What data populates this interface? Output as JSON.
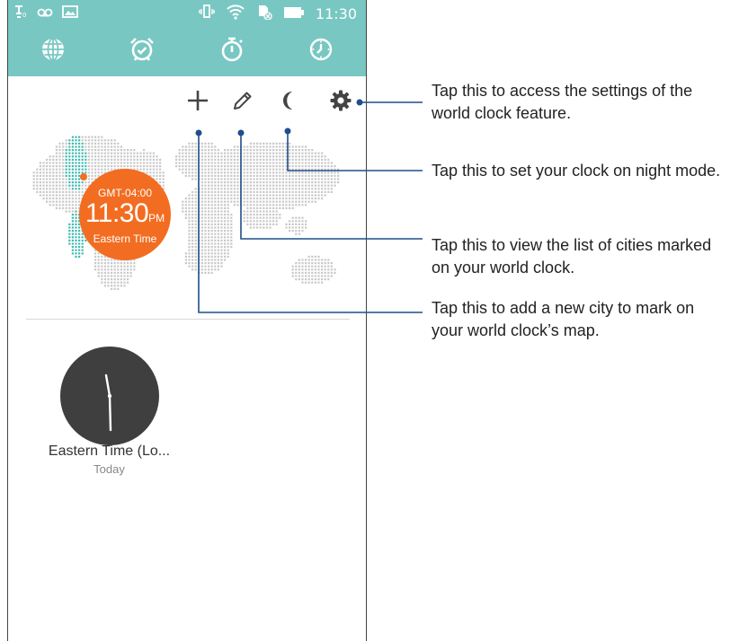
{
  "status_bar": {
    "time": "11:30",
    "icons": [
      "notification-icon",
      "voicemail-icon",
      "image-icon",
      "vibrate-icon",
      "wifi-icon",
      "no-sim-icon",
      "battery-icon"
    ]
  },
  "tabs": [
    {
      "id": "world-clock",
      "icon": "globe-icon",
      "active": true
    },
    {
      "id": "alarm",
      "icon": "alarm-clock-icon",
      "active": false
    },
    {
      "id": "stopwatch",
      "icon": "stopwatch-icon",
      "active": false
    },
    {
      "id": "timer",
      "icon": "timer-icon",
      "active": false
    }
  ],
  "toolbar": {
    "add_icon": "plus-icon",
    "edit_icon": "pencil-icon",
    "night_icon": "moon-icon",
    "settings_icon": "gear-icon"
  },
  "map_badge": {
    "gmt": "GMT-04:00",
    "time": "11:30",
    "ampm": "PM",
    "zone": "Eastern Time"
  },
  "city_card": {
    "name": "Eastern Time (Lo...",
    "day": "Today"
  },
  "callouts": [
    {
      "target": "settings",
      "text": "Tap this to access the settings of the world clock feature."
    },
    {
      "target": "night-mode",
      "text": "Tap this to set your clock on night mode."
    },
    {
      "target": "edit-list",
      "text": "Tap this to view the list of cities marked on your world clock."
    },
    {
      "target": "add-city",
      "text": "Tap this to add a new city to mark on your world clock’s map."
    }
  ],
  "colors": {
    "accent": "#79c7c2",
    "badge": "#f26d21",
    "clock_face": "#3f3f3f",
    "callout_line": "#1f4e8c",
    "map_dots": "#c9c9c9",
    "map_region_dots": "#3fbab0"
  }
}
